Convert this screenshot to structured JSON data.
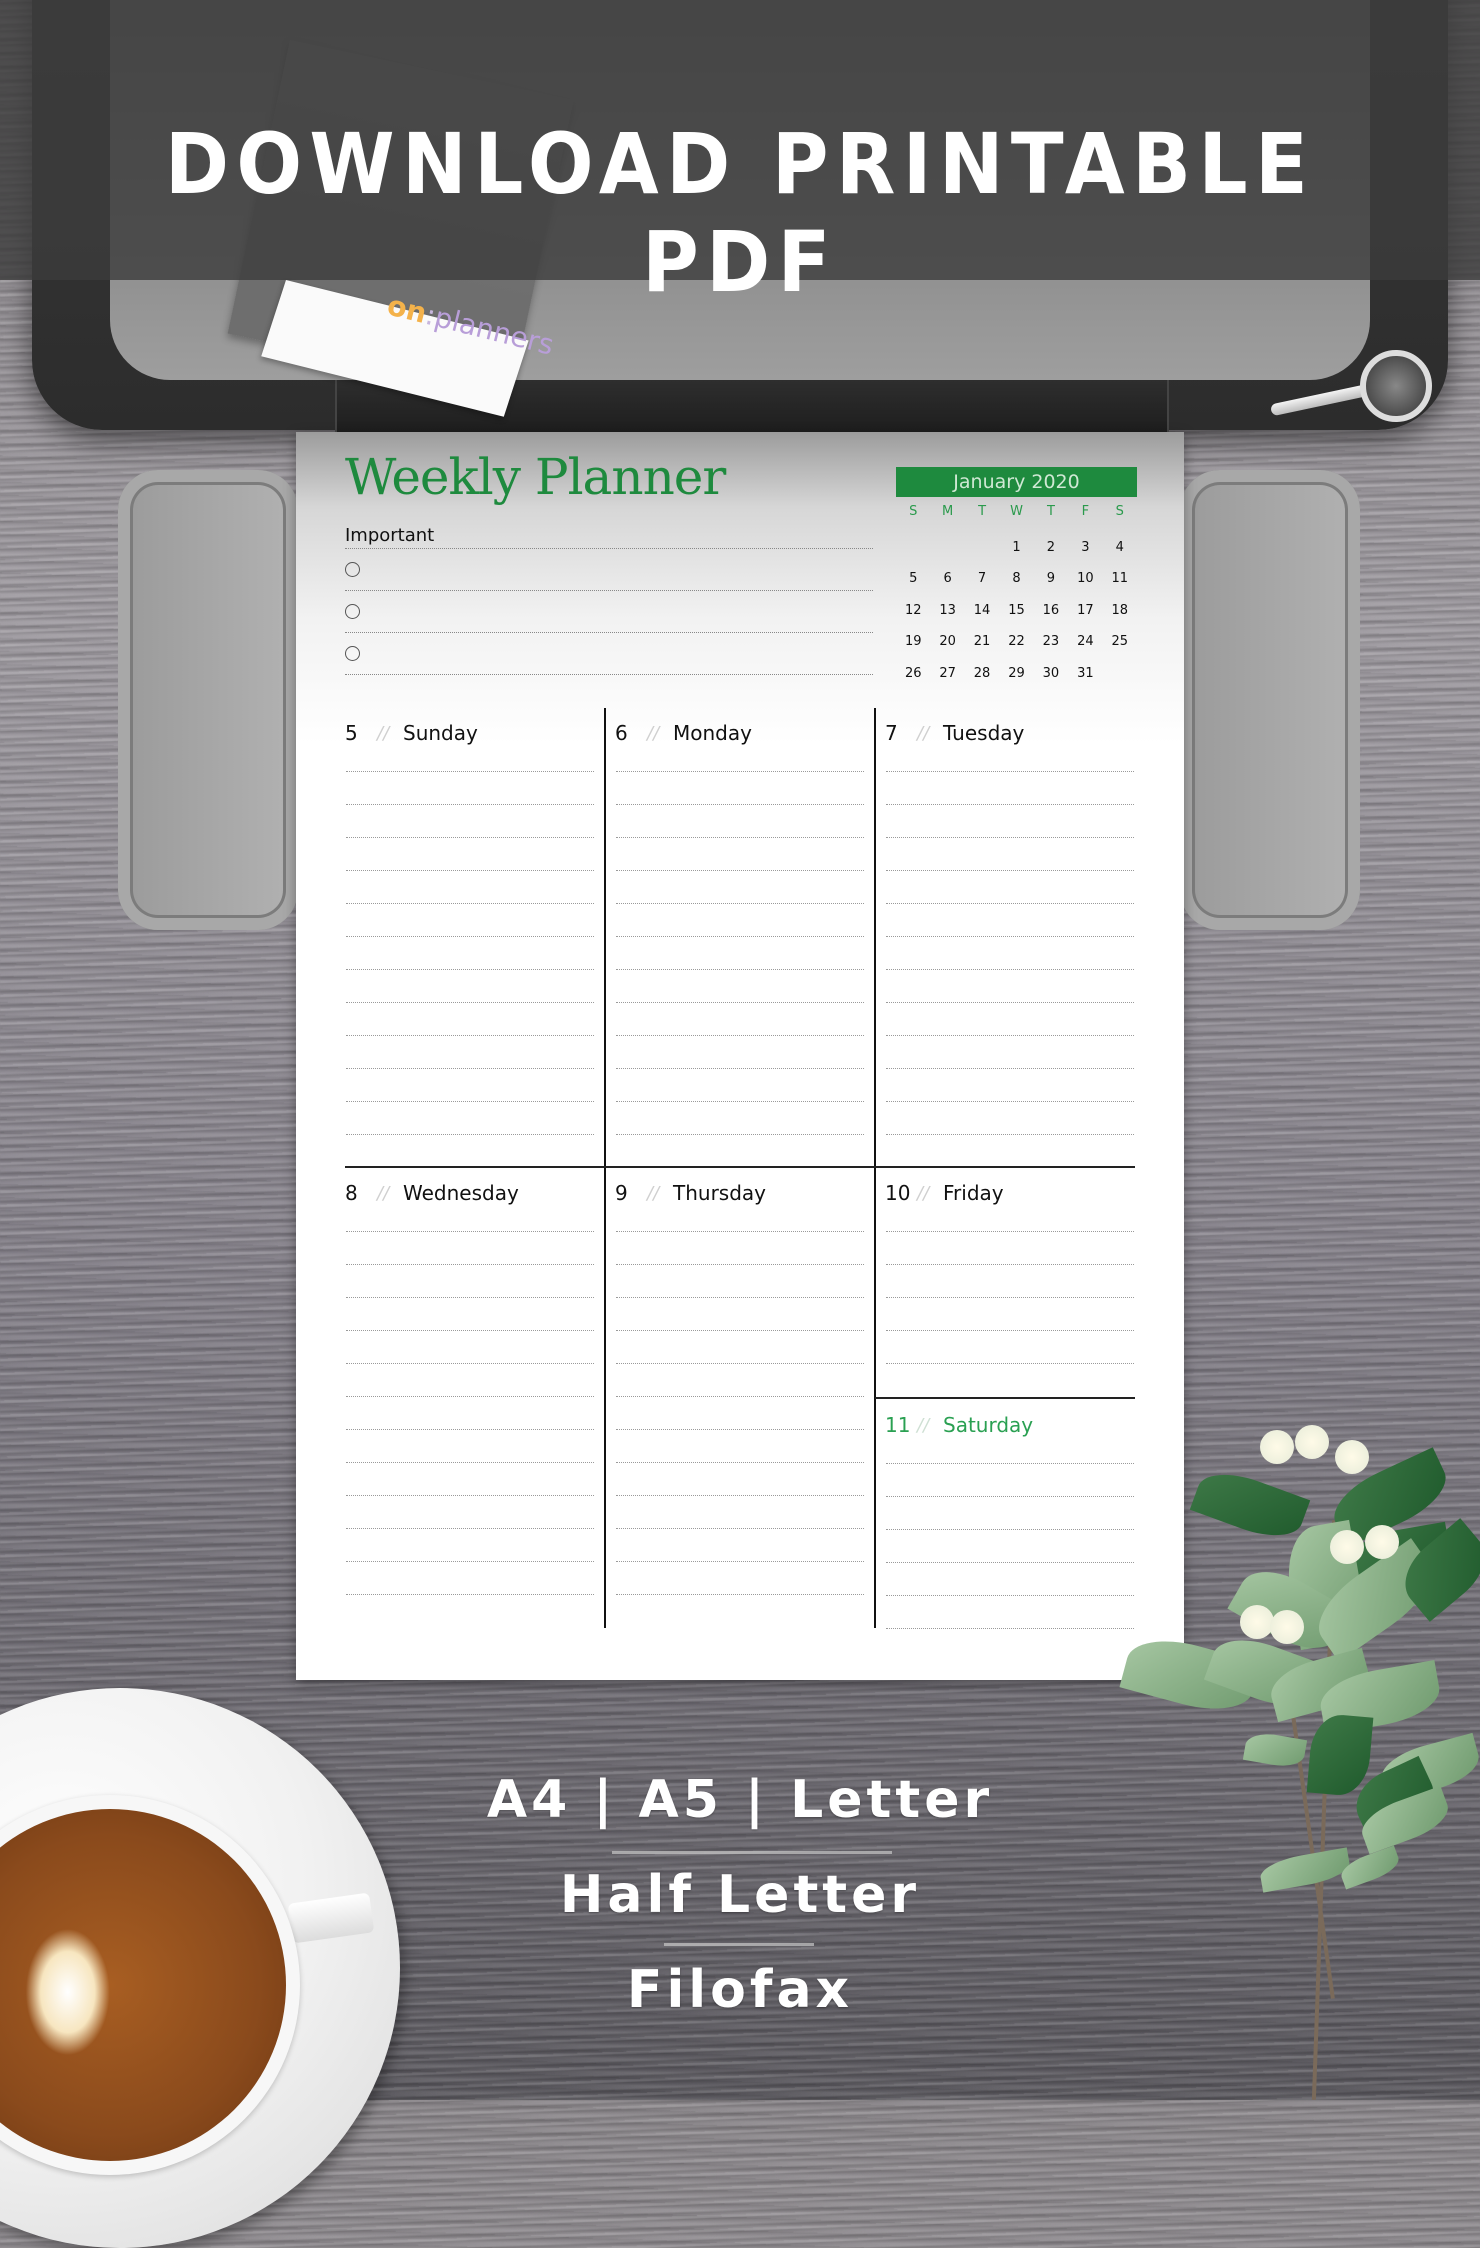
{
  "banner": {
    "title": "DOWNLOAD PRINTABLE PDF"
  },
  "brand": {
    "prefix": "on",
    "separator": ":",
    "name": "planners"
  },
  "planner": {
    "title": "Weekly Planner",
    "important": {
      "label": "Important",
      "items": 3
    },
    "mini_calendar": {
      "month_label": "January 2020",
      "weekdays": [
        "S",
        "M",
        "T",
        "W",
        "T",
        "F",
        "S"
      ],
      "weeks": [
        [
          "",
          "",
          "",
          "1",
          "2",
          "3",
          "4"
        ],
        [
          "5",
          "6",
          "7",
          "8",
          "9",
          "10",
          "11"
        ],
        [
          "12",
          "13",
          "14",
          "15",
          "16",
          "17",
          "18"
        ],
        [
          "19",
          "20",
          "21",
          "22",
          "23",
          "24",
          "25"
        ],
        [
          "26",
          "27",
          "28",
          "29",
          "30",
          "31",
          ""
        ]
      ]
    },
    "days": [
      {
        "num": "5",
        "name": "Sunday",
        "weekend": false
      },
      {
        "num": "6",
        "name": "Monday",
        "weekend": false
      },
      {
        "num": "7",
        "name": "Tuesday",
        "weekend": false
      },
      {
        "num": "8",
        "name": "Wednesday",
        "weekend": false
      },
      {
        "num": "9",
        "name": "Thursday",
        "weekend": false
      },
      {
        "num": "10",
        "name": "Friday",
        "weekend": false
      },
      {
        "num": "11",
        "name": "Saturday",
        "weekend": true
      }
    ],
    "separator_glyph": "//"
  },
  "formats": {
    "line1": "A4 | A5 | Letter",
    "line2": "Half Letter",
    "line3": "Filofax"
  },
  "colors": {
    "accent_green": "#1e8a3e",
    "weekend_green": "#2aa052",
    "brand_orange": "#f4b24a",
    "brand_purple": "#b89ed8"
  }
}
